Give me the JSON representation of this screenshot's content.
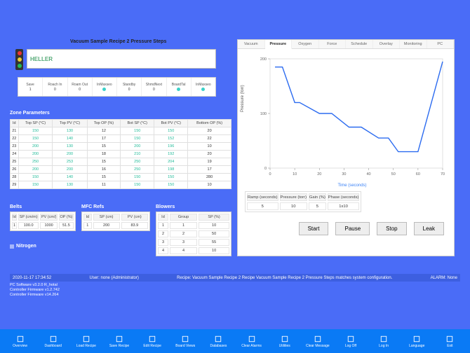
{
  "recipe_title": "Vacuum Sample Recipe 2 Pressure Steps",
  "brand": "HELLER",
  "summary": [
    {
      "label": "Save",
      "value": "1"
    },
    {
      "label": "Roach In",
      "value": "0"
    },
    {
      "label": "Roam Out",
      "value": "0"
    },
    {
      "label": "InMaxseo",
      "value": "dot"
    },
    {
      "label": "Standby",
      "value": "0"
    },
    {
      "label": "ShmdNext",
      "value": "0"
    },
    {
      "label": "BoardTal",
      "value": "dot"
    },
    {
      "label": "InMaxseo",
      "value": "dot"
    }
  ],
  "zone": {
    "title": "Zone Parameters",
    "headers": [
      "Id",
      "Top SP (°C)",
      "Top PV (°C)",
      "Top OP (%)",
      "Bot SP (°C)",
      "Bot PV (°C)",
      "Bottom OP (%)"
    ],
    "rows": [
      [
        "21",
        "150",
        "130",
        "12",
        "150",
        "150",
        "20"
      ],
      [
        "22",
        "150",
        "140",
        "17",
        "150",
        "152",
        "22"
      ],
      [
        "23",
        "200",
        "130",
        "15",
        "200",
        "196",
        "10"
      ],
      [
        "24",
        "200",
        "200",
        "18",
        "210",
        "192",
        "20"
      ],
      [
        "25",
        "250",
        "253",
        "15",
        "250",
        "204",
        "19"
      ],
      [
        "26",
        "200",
        "200",
        "16",
        "250",
        "198",
        "17"
      ],
      [
        "28",
        "150",
        "140",
        "15",
        "150",
        "150",
        "280"
      ],
      [
        "29",
        "150",
        "130",
        "11",
        "150",
        "150",
        "10"
      ]
    ]
  },
  "belts": {
    "title": "Belts",
    "headers": [
      "Id",
      "SP (cm/m)",
      "PV (cm/)",
      "OP (%)"
    ],
    "rows": [
      [
        "1",
        "100.0",
        "1000",
        "51.5"
      ]
    ]
  },
  "mfc": {
    "title": "MFC Refs",
    "headers": [
      "Id",
      "SP (cm)",
      "PV (cm)"
    ],
    "rows": [
      [
        "1",
        "200",
        "83.9"
      ]
    ]
  },
  "blowers": {
    "title": "Blowers",
    "headers": [
      "Id",
      "Group",
      "SP (%)"
    ],
    "rows": [
      [
        "1",
        "1",
        "10"
      ],
      [
        "2",
        "2",
        "50"
      ],
      [
        "3",
        "3",
        "55"
      ],
      [
        "4",
        "4",
        "10"
      ]
    ]
  },
  "nitrogen": "Nitrogen",
  "tabs": [
    "Vacuum",
    "Pressure",
    "Oxygen",
    "Force",
    "Schedule",
    "Overlay",
    "Monitoring",
    "PC"
  ],
  "active_tab": 1,
  "chart": {
    "ylabel": "Pressure (torr)",
    "xlabel": "Time (seconds)"
  },
  "chart_data": {
    "type": "line",
    "title": "",
    "xlabel": "Time (seconds)",
    "ylabel": "Pressure (torr)",
    "ylim": [
      0,
      200
    ],
    "xlim": [
      0,
      70
    ],
    "yticks": [
      0,
      100,
      200
    ],
    "xticks": [
      0,
      10,
      20,
      30,
      40,
      50,
      60,
      70
    ],
    "x": [
      2,
      5,
      10,
      12,
      20,
      25,
      32,
      37,
      44,
      48,
      52,
      60,
      70
    ],
    "values": [
      185,
      185,
      120,
      120,
      100,
      100,
      75,
      75,
      55,
      55,
      30,
      30,
      195
    ]
  },
  "result": {
    "headers": [
      "Ramp (seconds)",
      "Pressure (torr)",
      "Gain (%)",
      "Phase (seconds)"
    ],
    "rows": [
      [
        "5",
        "10",
        "5",
        "1x10"
      ]
    ]
  },
  "controls": {
    "start": "Start",
    "pause": "Pause",
    "stop": "Stop",
    "leak": "Leak"
  },
  "status": {
    "left": "2020-11-17 17:34:52",
    "user": "User: none (Administrator)",
    "mid": "Recipe: Vacuum Sample Recipe 2   Recipe Vacuum Sample Recipe 2 Pressure Steps matches system configuration.",
    "right": "ALARM: None"
  },
  "footer": {
    "line1": "PC Software v3.2.0 R_hotal",
    "line2": "Controller Firmware v1.2.742",
    "line3": "Controller Firmware v14.264"
  },
  "toolbar": [
    "Overview",
    "Dashboard",
    "Load Recipe",
    "Save Recipe",
    "Edit Recipe",
    "Board Views",
    "Databases",
    "Clear Alarms",
    "Utilities",
    "Clear Message",
    "Log Off",
    "Log In",
    "Language",
    "Exit"
  ]
}
